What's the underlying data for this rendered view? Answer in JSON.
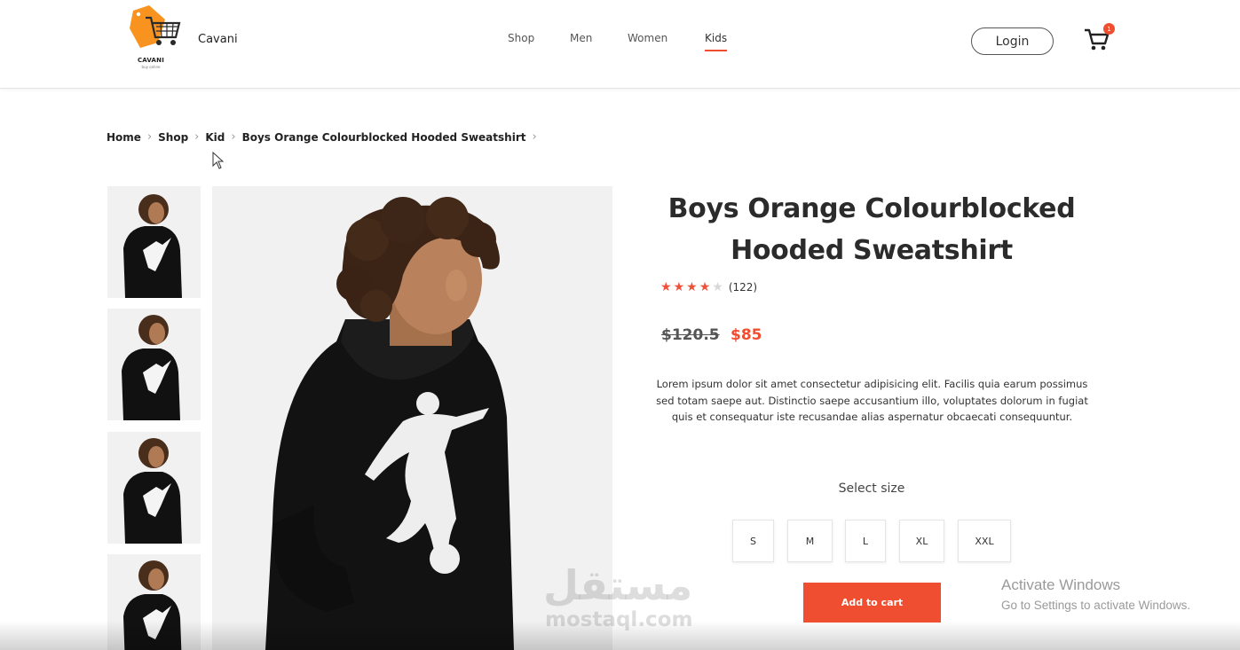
{
  "header": {
    "logo_text": "CAVANI",
    "logo_subtext": "buy online",
    "brand": "Cavani",
    "nav": [
      {
        "label": "Shop",
        "active": false
      },
      {
        "label": "Men",
        "active": false
      },
      {
        "label": "Women",
        "active": false
      },
      {
        "label": "Kids",
        "active": true
      }
    ],
    "login_label": "Login",
    "cart_icon": "cart-icon",
    "cart_count": "1"
  },
  "breadcrumb": [
    "Home",
    "Shop",
    "Kid",
    "Boys Orange Colourblocked Hooded Sweatshirt"
  ],
  "gallery": {
    "thumbnail_count": 4
  },
  "product": {
    "title_line1": "Boys Orange Colourblocked",
    "title_line2": "Hooded Sweatshirt",
    "rating": 4,
    "rating_max": 5,
    "review_count": "(122)",
    "old_price": "$120.5",
    "new_price": "$85",
    "description": "Lorem ipsum dolor sit amet consectetur adipisicing elit. Facilis quia earum possimus sed totam saepe aut. Distinctio saepe accusantium illo, voluptates dolorum in fugiat quis et consequatur iste recusandae alias aspernatur obcaecati consequuntur.",
    "select_size_label": "Select size",
    "sizes": [
      "S",
      "M",
      "L",
      "XL",
      "XXL"
    ],
    "add_to_cart_label": "Add to cart"
  },
  "overlay": {
    "watermark_arabic": "مستقل",
    "watermark_latin": "mostaql.com",
    "activate_title": "Activate Windows",
    "activate_subtitle": "Go to Settings to activate Windows."
  },
  "colors": {
    "accent": "#f04e30",
    "logo_orange": "#f7931e",
    "text_dark": "#2b2b2b"
  }
}
